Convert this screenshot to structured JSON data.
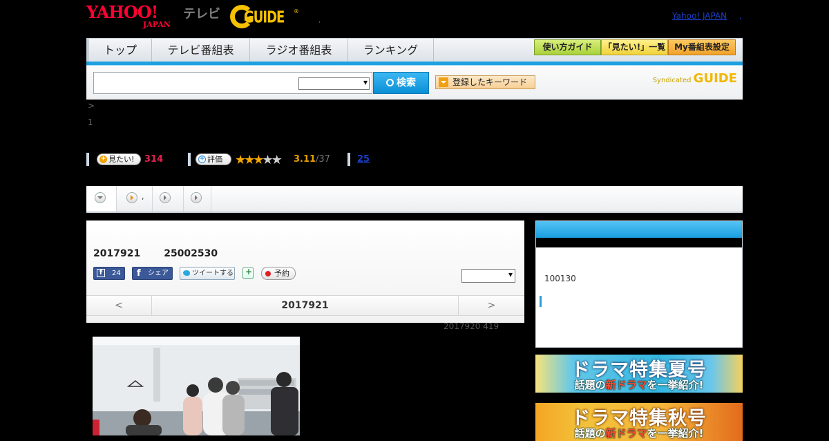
{
  "header": {
    "yahoo_logo": "YAHOO!",
    "japan_logo": "JAPAN",
    "tv_logo": "テレビ",
    "gguide_logo": "GUIDE",
    "gguide_mark": "®",
    "dot": ",",
    "yahoo_japan_link": "Yahoo! JAPAN",
    "link_dot": ","
  },
  "nav": {
    "items": [
      "トップ",
      "テレビ番組表",
      "ラジオ番組表",
      "ランキング"
    ],
    "buttons": [
      "使い方ガイド",
      "「見たい!」一覧",
      "My番組表設定"
    ],
    "accent": "#1ea0e0"
  },
  "search": {
    "button": "検索",
    "keyword_button": "登録したキーワード",
    "syndicated": "Syndicated",
    "syndicated_logo": "GUIDE"
  },
  "breadcrumb": ">",
  "page_num": "1",
  "rating": {
    "mitai_label": "見たい!",
    "mitai_count": "314",
    "hyoka_label": "評価",
    "stars_filled": 3,
    "stars_total": 5,
    "score": "3.11",
    "score_count": "/37",
    "review_count": "25"
  },
  "tabs": {
    "dot_label": ","
  },
  "program": {
    "date": "2017921",
    "time": "25002530",
    "like_count": "24",
    "share_label": "シェア",
    "tweet_label": "ツイートする",
    "reserve_label": "予約",
    "prev": "<",
    "current_day": "2017921",
    "next": ">",
    "sub_info": "2017920  419"
  },
  "right": {
    "box_text": "100130"
  },
  "banners": {
    "summer_title": "ドラマ特集夏号",
    "summer_sub_pre": "話題の",
    "summer_sub_hi": "新ドラマ",
    "summer_sub_post": "を一挙紹介!",
    "autumn_title": "ドラマ特集秋号",
    "autumn_sub_pre": "話題の",
    "autumn_sub_hi": "新ドラマ",
    "autumn_sub_post": "を一挙紹介!"
  }
}
